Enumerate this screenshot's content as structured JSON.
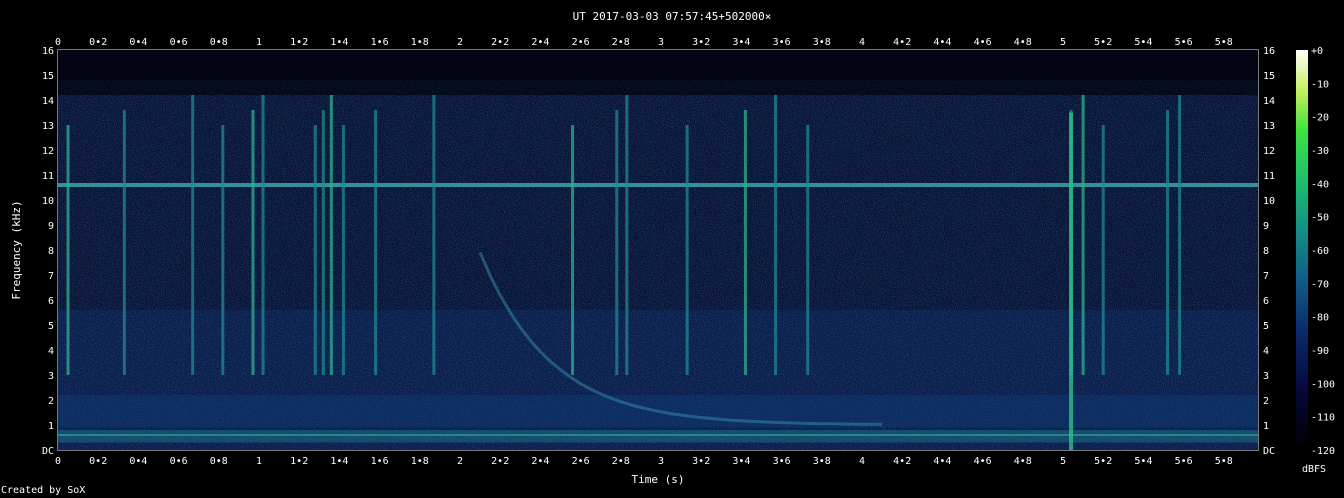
{
  "chart_data": {
    "type": "heatmap",
    "title": "UT 2017-03-03 07:57:45+502000×",
    "xlabel": "Time (s)",
    "ylabel": "Frequency (kHz)",
    "xlim": [
      0,
      5.97
    ],
    "ylim": [
      0,
      16
    ],
    "x_ticks": [
      "0",
      "0•2",
      "0•4",
      "0•6",
      "0•8",
      "1",
      "1•2",
      "1•4",
      "1•6",
      "1•8",
      "2",
      "2•2",
      "2•4",
      "2•6",
      "2•8",
      "3",
      "3•2",
      "3•4",
      "3•6",
      "3•8",
      "4",
      "4•2",
      "4•4",
      "4•6",
      "4•8",
      "5",
      "5•2",
      "5•4",
      "5•6",
      "5•8"
    ],
    "y_ticks": [
      "DC",
      "1",
      "2",
      "3",
      "4",
      "5",
      "6",
      "7",
      "8",
      "9",
      "10",
      "11",
      "12",
      "13",
      "14",
      "15",
      "16"
    ],
    "colorbar": {
      "label": "dBFS",
      "range": [
        -120,
        0
      ],
      "ticks": [
        "+0",
        "-10",
        "-20",
        "-30",
        "-40",
        "-50",
        "-60",
        "-70",
        "-80",
        "-90",
        "-100",
        "-110",
        "-120"
      ]
    },
    "features": {
      "constant_tone_khz": 10.6,
      "low_band_khz": [
        0.3,
        0.8
      ],
      "broadband_impulses_s": [
        0.05,
        0.33,
        0.67,
        0.82,
        0.97,
        1.02,
        1.28,
        1.32,
        1.36,
        1.42,
        1.58,
        1.87,
        2.56,
        2.78,
        2.83,
        3.13,
        3.42,
        3.57,
        3.73,
        5.04,
        5.1,
        5.2,
        5.52,
        5.58
      ]
    }
  },
  "footer": {
    "credit": "Created by SoX"
  }
}
